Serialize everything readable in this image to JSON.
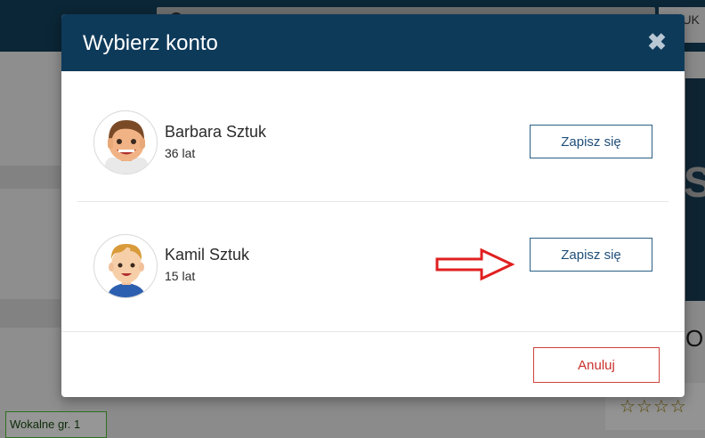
{
  "background": {
    "user_chip": "SZTUK",
    "side_glyph": "St",
    "side_letter": "O",
    "stars": "☆☆☆☆",
    "class_tag": "Wokalne gr. 1"
  },
  "modal": {
    "title": "Wybierz konto",
    "close_glyph": "✖",
    "accounts": [
      {
        "name": "Barbara Sztuk",
        "age": "36 lat",
        "button_label": "Zapisz się",
        "avatar": "adult-avatar-icon"
      },
      {
        "name": "Kamil Sztuk",
        "age": "15 lat",
        "button_label": "Zapisz się",
        "avatar": "child-avatar-icon"
      }
    ],
    "cancel_label": "Anuluj"
  },
  "colors": {
    "header": "#0e3a5a",
    "button_border": "#2a5f86",
    "cancel": "#c9302c",
    "annotation_arrow": "#e02020"
  }
}
